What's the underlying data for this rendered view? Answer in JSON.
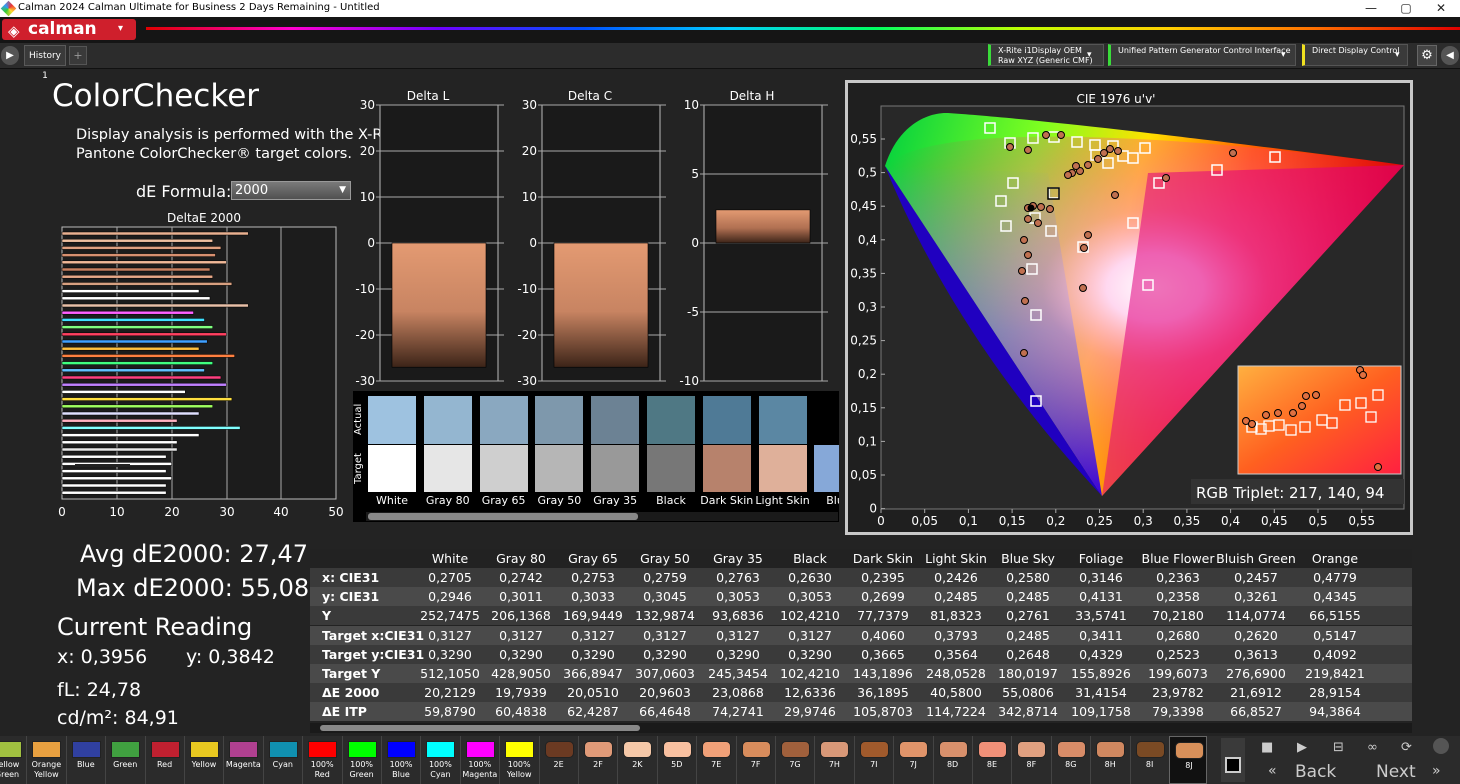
{
  "window": {
    "title": "Calman 2024 Calman Ultimate for Business 2 Days Remaining  - Untitled",
    "min": "—",
    "max": "▢",
    "close": "✕"
  },
  "brand": {
    "logo": "calman",
    "tab": "History 1",
    "add_tab": "+"
  },
  "devices": [
    {
      "label": "X-Rite i1Display OEM\nRaw XYZ (Generic CMF)",
      "color": "#3adc3a"
    },
    {
      "label": "Unified Pattern Generator Control Interface",
      "color": "#3adc3a"
    },
    {
      "label": "Direct Display Control",
      "color": "#f0e020"
    }
  ],
  "header": {
    "title": "ColorChecker",
    "description": "Display analysis is performed with the X-Rite/\nPantone ColorChecker® target colors.",
    "formula_label": "dE Formula:",
    "formula_value": "2000"
  },
  "delta_e_chart": {
    "title": "DeltaE 2000",
    "ticks": [
      "0",
      "10",
      "20",
      "30",
      "40",
      "50"
    ]
  },
  "summary": {
    "avg": "Avg dE2000: 27,47",
    "max": "Max dE2000: 55,08",
    "current": "Current Reading",
    "x": "x: 0,3956",
    "y": "y: 0,3842",
    "fl": "fL: 24,78",
    "cdm": "cd/m²: 84,91"
  },
  "delta_charts": [
    {
      "title": "Delta L",
      "ticks": [
        "30",
        "20",
        "10",
        "0",
        "-10",
        "-20",
        "-30"
      ],
      "value": -27,
      "range": [
        -30,
        30
      ],
      "color_top": "#e39a72",
      "color_bottom": "#3c2418"
    },
    {
      "title": "Delta C",
      "ticks": [
        "30",
        "20",
        "10",
        "0",
        "-10",
        "-20",
        "-30"
      ],
      "value": -27,
      "range": [
        -30,
        30
      ],
      "color_top": "#e39a72",
      "color_bottom": "#3c2418"
    },
    {
      "title": "Delta H",
      "ticks": [
        "10",
        "5",
        "0",
        "-5",
        "-10"
      ],
      "value": 2.4,
      "range": [
        -10,
        10
      ],
      "color_top": "#e39a72",
      "color_bottom": "#3c2418"
    }
  ],
  "swatches": {
    "actual_label": "Actual",
    "target_label": "Target",
    "items": [
      {
        "name": "White",
        "actual": "#9ec2e0",
        "target": "#ffffff"
      },
      {
        "name": "Gray 80",
        "actual": "#94b6d0",
        "target": "#e6e6e6"
      },
      {
        "name": "Gray 65",
        "actual": "#8aa8c0",
        "target": "#cfcfcf"
      },
      {
        "name": "Gray 50",
        "actual": "#7e98ac",
        "target": "#b6b6b6"
      },
      {
        "name": "Gray 35",
        "actual": "#6c8294",
        "target": "#999999"
      },
      {
        "name": "Black",
        "actual": "#4f7884",
        "target": "#777777"
      },
      {
        "name": "Dark Skin",
        "actual": "#4f7a96",
        "target": "#b7826c"
      },
      {
        "name": "Light Skin",
        "actual": "#5b87a3",
        "target": "#dfb09a"
      },
      {
        "name": "Blue",
        "actual": "#000000",
        "target": "#86a8d8"
      }
    ]
  },
  "cie_chart": {
    "title": "CIE 1976 u'v'",
    "rgb": "RGB Triplet: 217, 140, 94",
    "xticks": [
      "0",
      "0,05",
      "0,1",
      "0,15",
      "0,2",
      "0,25",
      "0,3",
      "0,35",
      "0,4",
      "0,45",
      "0,5",
      "0,55"
    ],
    "yticks": [
      "0,55",
      "0,5",
      "0,45",
      "0,4",
      "0,35",
      "0,3",
      "0,25",
      "0,2",
      "0,15",
      "0,1",
      "0,05",
      "0"
    ]
  },
  "table": {
    "columns": [
      "White",
      "Gray 80",
      "Gray 65",
      "Gray 50",
      "Gray 35",
      "Black",
      "Dark Skin",
      "Light Skin",
      "Blue Sky",
      "Foliage",
      "Blue Flower",
      "Bluish Green",
      "Orange"
    ],
    "rows": [
      {
        "label": "x: CIE31",
        "values": [
          "0,2705",
          "0,2742",
          "0,2753",
          "0,2759",
          "0,2763",
          "0,2630",
          "0,2395",
          "0,2426",
          "0,2580",
          "0,3146",
          "0,2363",
          "0,2457",
          "0,4779"
        ]
      },
      {
        "label": "y: CIE31",
        "values": [
          "0,2946",
          "0,3011",
          "0,3033",
          "0,3045",
          "0,3053",
          "0,3053",
          "0,2699",
          "0,2485",
          "0,2485",
          "0,4131",
          "0,2358",
          "0,3261",
          "0,4345"
        ]
      },
      {
        "label": "Y",
        "values": [
          "252,7475",
          "206,1368",
          "169,9449",
          "132,9874",
          "93,6836",
          "102,4210",
          "77,7379",
          "81,8323",
          "0,2761",
          "33,5741",
          "70,2180",
          "114,0774",
          "66,5155"
        ]
      },
      {
        "label": "Target x:CIE31",
        "values": [
          "0,3127",
          "0,3127",
          "0,3127",
          "0,3127",
          "0,3127",
          "0,3127",
          "0,4060",
          "0,3793",
          "0,2485",
          "0,3411",
          "0,2680",
          "0,2620",
          "0,5147"
        ]
      },
      {
        "label": "Target y:CIE31",
        "values": [
          "0,3290",
          "0,3290",
          "0,3290",
          "0,3290",
          "0,3290",
          "0,3290",
          "0,3665",
          "0,3564",
          "0,2648",
          "0,4329",
          "0,2523",
          "0,3613",
          "0,4092"
        ]
      },
      {
        "label": "Target Y",
        "values": [
          "512,1050",
          "428,9050",
          "366,8947",
          "307,0603",
          "245,3454",
          "102,4210",
          "143,1896",
          "248,0528",
          "180,0197",
          "155,8926",
          "199,6073",
          "276,6900",
          "219,8421"
        ]
      },
      {
        "label": "ΔE 2000",
        "values": [
          "20,2129",
          "19,7939",
          "20,0510",
          "20,9603",
          "23,0868",
          "12,6336",
          "36,1895",
          "40,5800",
          "55,0806",
          "31,4154",
          "23,9782",
          "21,6912",
          "28,9154"
        ]
      },
      {
        "label": "ΔE ITP",
        "values": [
          "59,8790",
          "60,4838",
          "62,4287",
          "66,4648",
          "74,2741",
          "29,9746",
          "105,8703",
          "114,7224",
          "342,8714",
          "109,1758",
          "79,3398",
          "66,8527",
          "94,3864"
        ]
      }
    ]
  },
  "bottom": {
    "items": [
      {
        "label": "Yellow Green",
        "color": "#a0c040"
      },
      {
        "label": "Orange Yellow",
        "color": "#e8a040"
      },
      {
        "label": "Blue",
        "color": "#3040a0"
      },
      {
        "label": "Green",
        "color": "#40a040"
      },
      {
        "label": "Red",
        "color": "#c02030"
      },
      {
        "label": "Yellow",
        "color": "#e8c820"
      },
      {
        "label": "Magenta",
        "color": "#b04090"
      },
      {
        "label": "Cyan",
        "color": "#1090b0"
      },
      {
        "label": "100% Red",
        "color": "#ff0000"
      },
      {
        "label": "100% Green",
        "color": "#00ff00"
      },
      {
        "label": "100% Blue",
        "color": "#0000ff"
      },
      {
        "label": "100% Cyan",
        "color": "#00ffff"
      },
      {
        "label": "100% Magenta",
        "color": "#ff00ff"
      },
      {
        "label": "100% Yellow",
        "color": "#ffff00"
      },
      {
        "label": "2E",
        "color": "#6b3a22"
      },
      {
        "label": "2F",
        "color": "#e09a78"
      },
      {
        "label": "2K",
        "color": "#f5c8a8"
      },
      {
        "label": "5D",
        "color": "#f8c0a0"
      },
      {
        "label": "7E",
        "color": "#f0a078"
      },
      {
        "label": "7F",
        "color": "#d88c5c"
      },
      {
        "label": "7G",
        "color": "#a0603c"
      },
      {
        "label": "7H",
        "color": "#d89878"
      },
      {
        "label": "7I",
        "color": "#a05a2c"
      },
      {
        "label": "7J",
        "color": "#e0946a"
      },
      {
        "label": "8D",
        "color": "#d8906c"
      },
      {
        "label": "8E",
        "color": "#f09078"
      },
      {
        "label": "8F",
        "color": "#e0a080"
      },
      {
        "label": "8G",
        "color": "#d88c68"
      },
      {
        "label": "8H",
        "color": "#d08860"
      },
      {
        "label": "8I",
        "color": "#7a4a24"
      },
      {
        "label": "8J",
        "color": "#d8905a"
      }
    ],
    "back": "Back",
    "next": "Next"
  }
}
